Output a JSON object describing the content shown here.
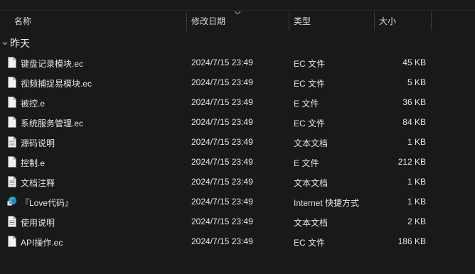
{
  "columns": {
    "name": "名称",
    "date": "修改日期",
    "type": "类型",
    "size": "大小"
  },
  "group": {
    "label": "昨天"
  },
  "files": [
    {
      "name": "键盘记录模块.ec",
      "date": "2024/7/15 23:49",
      "type": "EC 文件",
      "size": "45 KB",
      "icon": "file-icon"
    },
    {
      "name": "视频捕捉易模块.ec",
      "date": "2024/7/15 23:49",
      "type": "EC 文件",
      "size": "5 KB",
      "icon": "file-icon"
    },
    {
      "name": "被控.e",
      "date": "2024/7/15 23:49",
      "type": "E 文件",
      "size": "36 KB",
      "icon": "file-icon"
    },
    {
      "name": "系统服务管理.ec",
      "date": "2024/7/15 23:49",
      "type": "EC 文件",
      "size": "84 KB",
      "icon": "file-icon"
    },
    {
      "name": "源码说明",
      "date": "2024/7/15 23:49",
      "type": "文本文档",
      "size": "1 KB",
      "icon": "text-file-icon"
    },
    {
      "name": "控制.e",
      "date": "2024/7/15 23:49",
      "type": "E 文件",
      "size": "212 KB",
      "icon": "file-icon"
    },
    {
      "name": "文档注释",
      "date": "2024/7/15 23:49",
      "type": "文本文档",
      "size": "1 KB",
      "icon": "text-file-icon"
    },
    {
      "name": "『Love代码』",
      "date": "2024/7/15 23:49",
      "type": "Internet 快捷方式",
      "size": "1 KB",
      "icon": "edge-shortcut-icon"
    },
    {
      "name": "使用说明",
      "date": "2024/7/15 23:49",
      "type": "文本文档",
      "size": "2 KB",
      "icon": "text-file-icon"
    },
    {
      "name": "API操作.ec",
      "date": "2024/7/15 23:49",
      "type": "EC 文件",
      "size": "186 KB",
      "icon": "file-icon"
    }
  ]
}
